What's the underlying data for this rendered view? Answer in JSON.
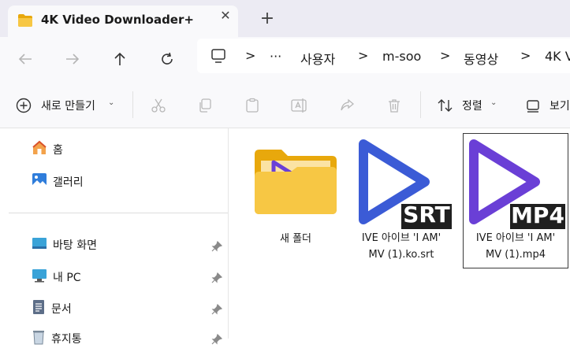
{
  "window": {
    "tab_title": "4K Video Downloader+",
    "close_glyph": "✕",
    "new_tab_glyph": "+"
  },
  "address_bar": {
    "overflow": "···",
    "crumbs": [
      "사용자",
      "m-soo",
      "동영상",
      "4K V"
    ],
    "separator": ">"
  },
  "command_bar": {
    "new_label": "새로 만들기",
    "sort_label": "정렬",
    "view_label": "보기"
  },
  "sidebar": {
    "items": [
      {
        "label": "홈",
        "icon": "home-icon"
      },
      {
        "label": "갤러리",
        "icon": "gallery-icon"
      },
      {
        "label": "바탕 화면",
        "icon": "desktop-icon",
        "pinned": true
      },
      {
        "label": "내 PC",
        "icon": "pc-icon",
        "pinned": true
      },
      {
        "label": "문서",
        "icon": "document-icon",
        "pinned": true
      },
      {
        "label": "휴지통",
        "icon": "recycle-bin-icon",
        "pinned": true
      }
    ]
  },
  "files": [
    {
      "name_line1": "새 폴더",
      "name_line2": "",
      "type": "folder"
    },
    {
      "name_line1": "IVE 아이브 'I AM'",
      "name_line2": "MV (1).ko.srt",
      "badge": "SRT",
      "accent": "#3b5bd6"
    },
    {
      "name_line1": "IVE 아이브 'I AM'",
      "name_line2": "MV (1).mp4",
      "badge": "MP4",
      "accent": "#6a3fd6",
      "selected": true
    }
  ],
  "colors": {
    "titlebar_bg": "#ecebf3",
    "chrome_bg": "#f9f9fb",
    "folder_yellow": "#f5c242",
    "play_blue": "#3b5bd6",
    "play_purple": "#6a3fd6"
  }
}
